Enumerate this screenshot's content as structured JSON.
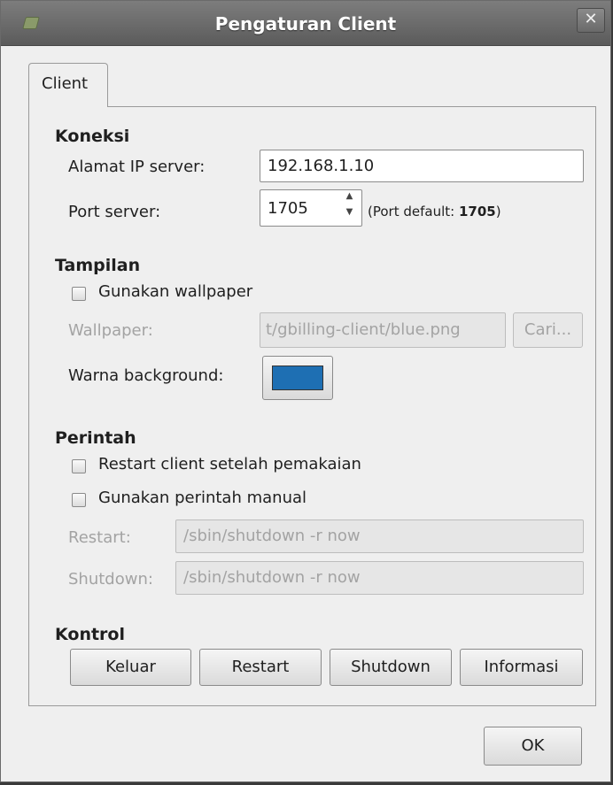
{
  "window": {
    "title": "Pengaturan Client",
    "close_symbol": "✕"
  },
  "tabs": [
    {
      "label": "Client",
      "active": true
    }
  ],
  "koneksi": {
    "heading": "Koneksi",
    "ip_label": "Alamat IP server:",
    "ip_value": "192.168.1.10",
    "port_label": "Port server:",
    "port_value": "1705",
    "port_hint_prefix": "(Port default: ",
    "port_hint_value": "1705",
    "port_hint_suffix": ")"
  },
  "tampilan": {
    "heading": "Tampilan",
    "use_wallpaper_label": "Gunakan wallpaper",
    "use_wallpaper_checked": false,
    "wallpaper_label": "Wallpaper:",
    "wallpaper_value": "t/gbilling-client/blue.png",
    "browse_label": "Cari...",
    "bg_color_label": "Warna background:",
    "bg_color": "#1e6fb3"
  },
  "perintah": {
    "heading": "Perintah",
    "restart_after_label": "Restart client setelah pemakaian",
    "restart_after_checked": false,
    "manual_cmd_label": "Gunakan perintah manual",
    "manual_cmd_checked": false,
    "restart_label": "Restart:",
    "restart_value": "/sbin/shutdown -r now",
    "shutdown_label": "Shutdown:",
    "shutdown_value": "/sbin/shutdown -r now"
  },
  "kontrol": {
    "heading": "Kontrol",
    "buttons": [
      "Keluar",
      "Restart",
      "Shutdown",
      "Informasi"
    ]
  },
  "footer": {
    "ok_label": "OK"
  }
}
